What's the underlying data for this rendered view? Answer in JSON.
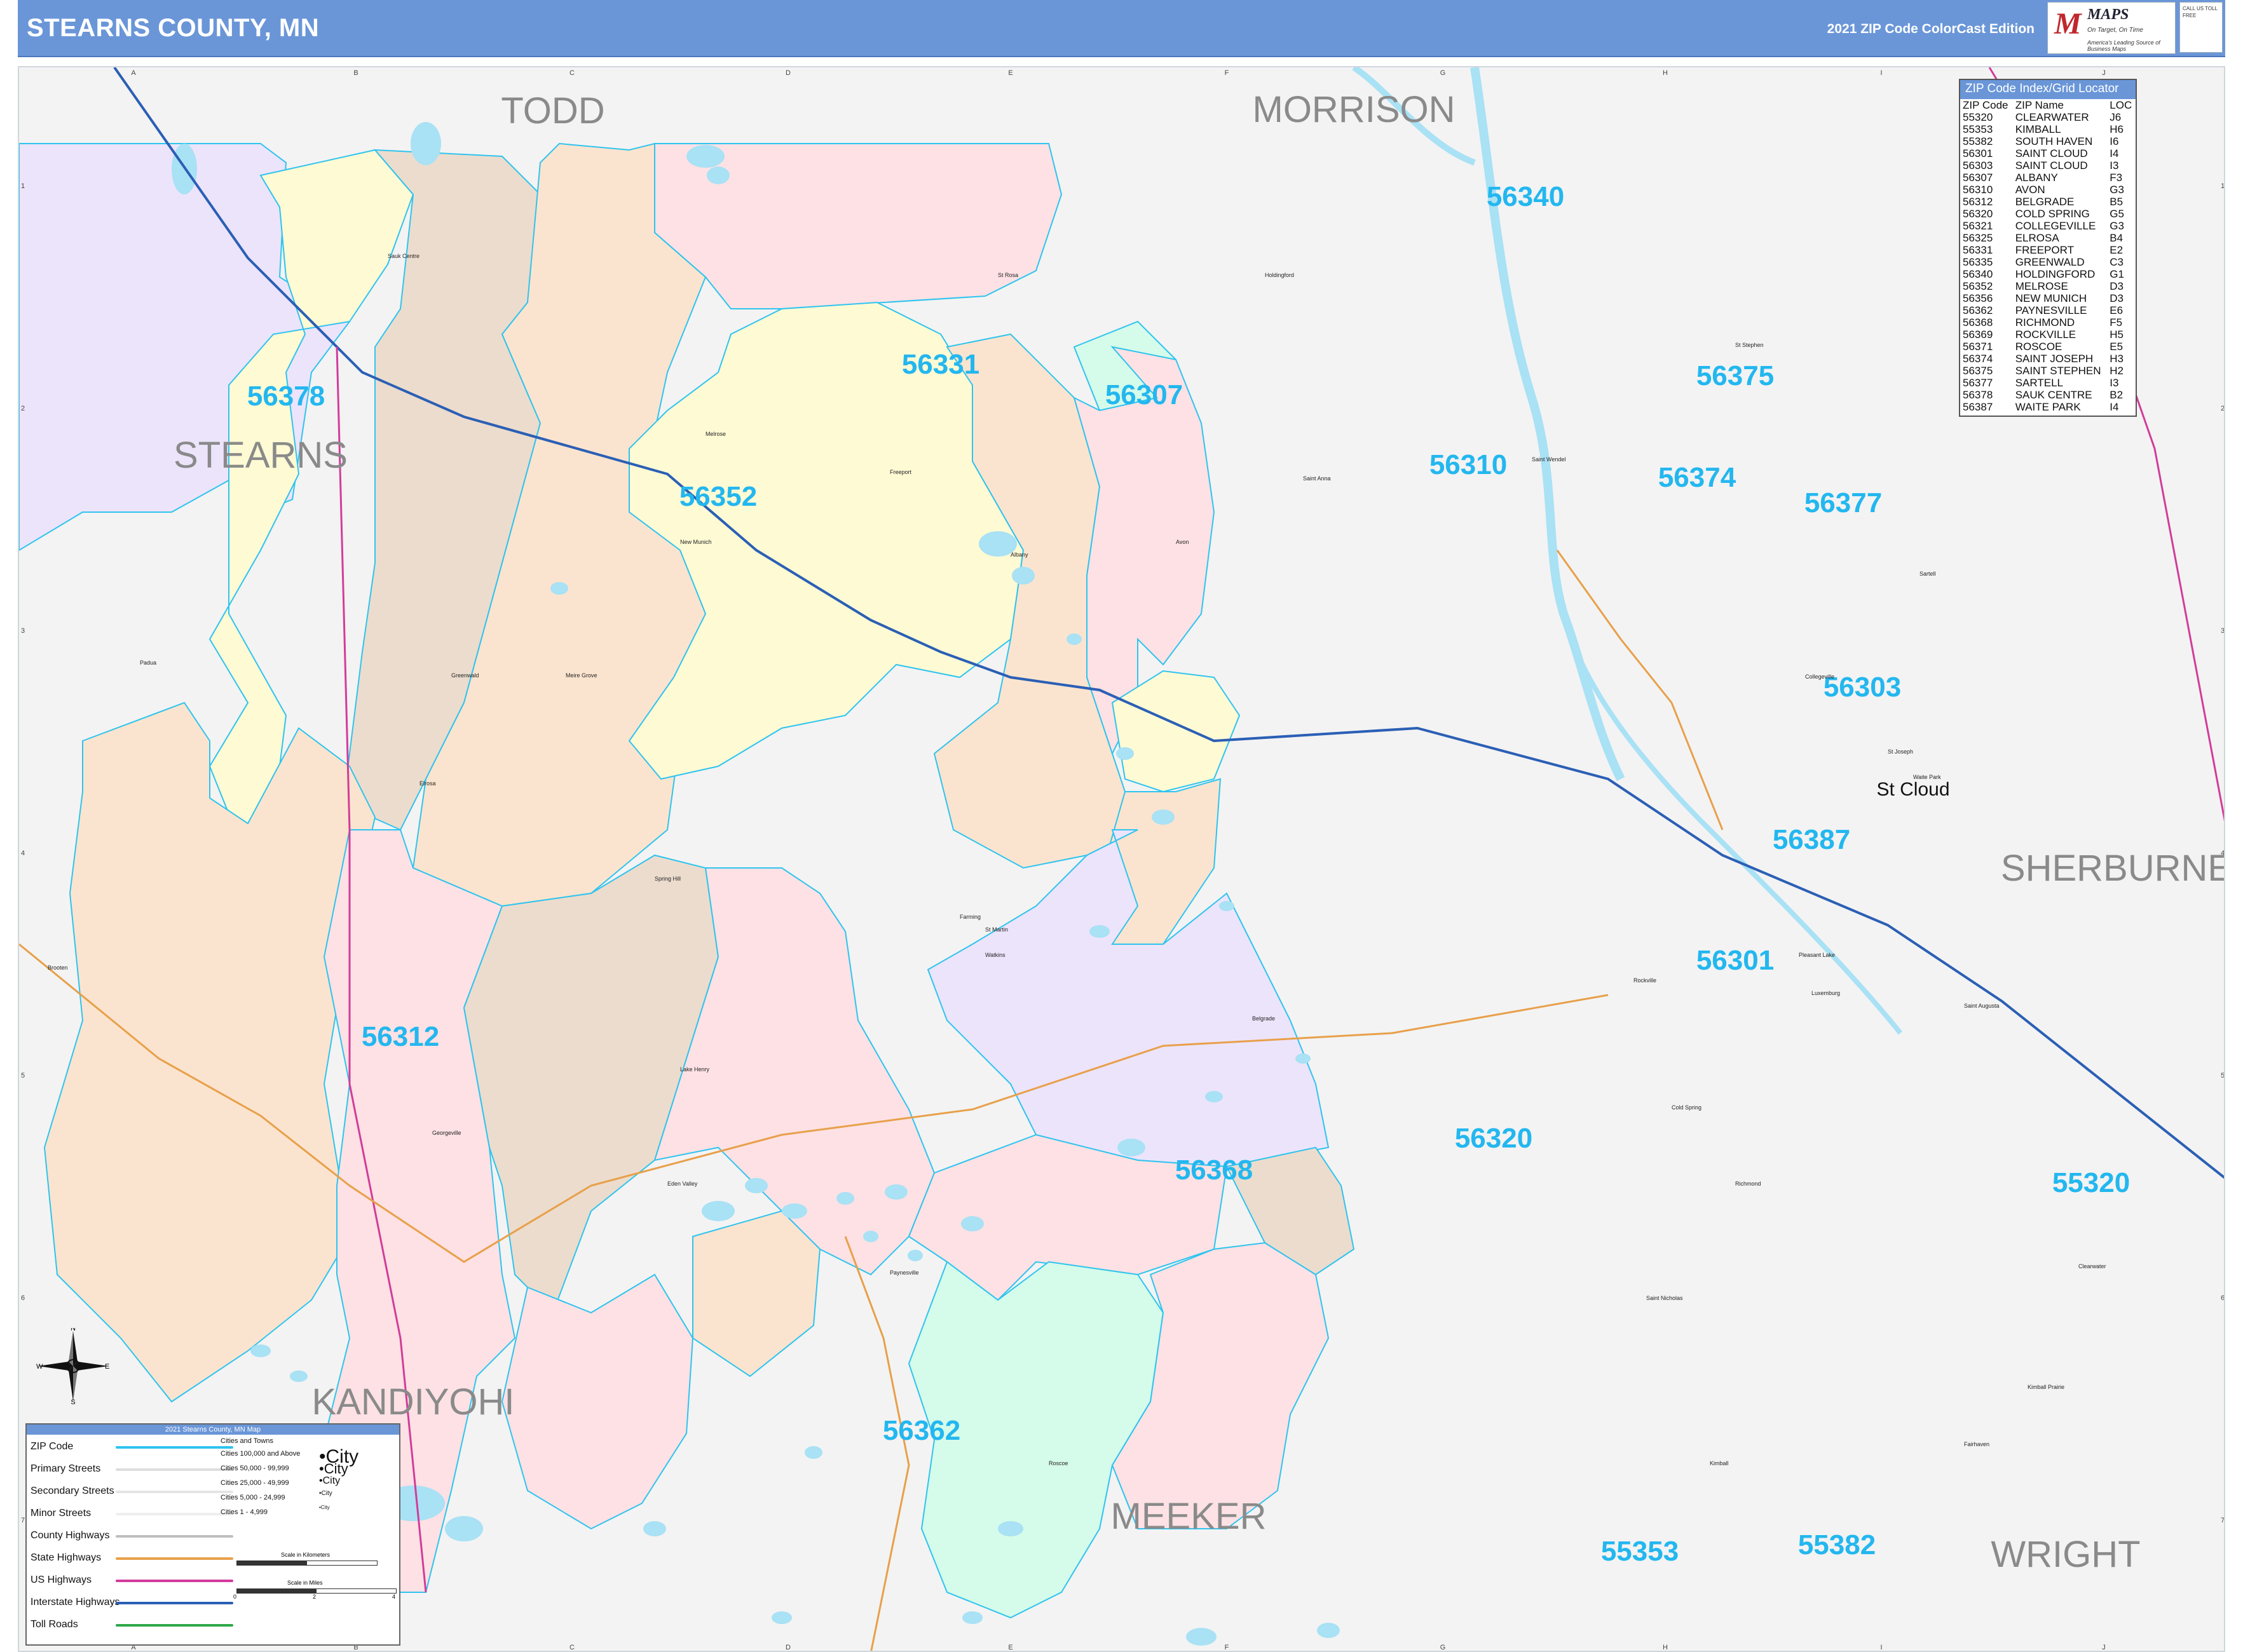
{
  "header": {
    "title": "STEARNS COUNTY, MN",
    "edition": "2021 ZIP Code ColorCast Edition",
    "brand_name": "MAPS",
    "brand_mark": "M",
    "brand_sub": "On Target, On Time",
    "brand_tag": "America's Leading Source of Business Maps",
    "contact": "CALL US TOLL FREE"
  },
  "counties": [
    "TODD",
    "MORRISON",
    "STEARNS",
    "SHERBURNE",
    "KANDIYOHI",
    "MEEKER",
    "WRIGHT"
  ],
  "zip_labels": [
    "56340",
    "56378",
    "56331",
    "56307",
    "56375",
    "56310",
    "56374",
    "56352",
    "56377",
    "56303",
    "56387",
    "56301",
    "56312",
    "56368",
    "56320",
    "55320",
    "56362",
    "55353",
    "55382"
  ],
  "city_label": "St Cloud",
  "towns": [
    "Sauk Centre",
    "Melrose",
    "Freeport",
    "New Munich",
    "Albany",
    "Avon",
    "Holdingford",
    "St Rosa",
    "St Stephen",
    "Saint Anna",
    "Saint Wendel",
    "Collegeville",
    "St Joseph",
    "Waite Park",
    "Sartell",
    "Cold Spring",
    "Richmond",
    "Roscoe",
    "Paynesville",
    "Kimball",
    "Clearwater",
    "Belgrade",
    "Brooten",
    "Elrosa",
    "Georgeville",
    "Lake Henry",
    "Farming",
    "St Martin",
    "Rockville",
    "Luxemburg",
    "Saint Augusta",
    "Pleasant Lake",
    "Saint Nicholas",
    "Eden Valley",
    "Greenwald",
    "Spring Hill",
    "Meire Grove",
    "Padua",
    "Watkins",
    "Fairhaven",
    "Kimball Prairie"
  ],
  "grid": {
    "letters": [
      "A",
      "B",
      "C",
      "D",
      "E",
      "F",
      "G",
      "H",
      "I",
      "J"
    ],
    "numbers": [
      "1",
      "2",
      "3",
      "4",
      "5",
      "6",
      "7"
    ]
  },
  "index": {
    "title": "ZIP Code Index/Grid Locator",
    "columns": [
      "ZIP Code",
      "ZIP Name",
      "LOC"
    ],
    "rows": [
      [
        "55320",
        "CLEARWATER",
        "J6"
      ],
      [
        "55353",
        "KIMBALL",
        "H6"
      ],
      [
        "55382",
        "SOUTH HAVEN",
        "I6"
      ],
      [
        "56301",
        "SAINT CLOUD",
        "I4"
      ],
      [
        "56303",
        "SAINT CLOUD",
        "I3"
      ],
      [
        "56307",
        "ALBANY",
        "F3"
      ],
      [
        "56310",
        "AVON",
        "G3"
      ],
      [
        "56312",
        "BELGRADE",
        "B5"
      ],
      [
        "56320",
        "COLD SPRING",
        "G5"
      ],
      [
        "56321",
        "COLLEGEVILLE",
        "G3"
      ],
      [
        "56325",
        "ELROSA",
        "B4"
      ],
      [
        "56331",
        "FREEPORT",
        "E2"
      ],
      [
        "56335",
        "GREENWALD",
        "C3"
      ],
      [
        "56340",
        "HOLDINGFORD",
        "G1"
      ],
      [
        "56352",
        "MELROSE",
        "D3"
      ],
      [
        "56356",
        "NEW MUNICH",
        "D3"
      ],
      [
        "56362",
        "PAYNESVILLE",
        "E6"
      ],
      [
        "56368",
        "RICHMOND",
        "F5"
      ],
      [
        "56369",
        "ROCKVILLE",
        "H5"
      ],
      [
        "56371",
        "ROSCOE",
        "E5"
      ],
      [
        "56374",
        "SAINT JOSEPH",
        "H3"
      ],
      [
        "56375",
        "SAINT STEPHEN",
        "H2"
      ],
      [
        "56377",
        "SARTELL",
        "I3"
      ],
      [
        "56378",
        "SAUK CENTRE",
        "B2"
      ],
      [
        "56387",
        "WAITE PARK",
        "I4"
      ]
    ]
  },
  "legend": {
    "title": "2021 Stearns County, MN Map",
    "cities_heading": "Cities and Towns",
    "rows": [
      {
        "label": "ZIP Code",
        "color": "#2ec4ef"
      },
      {
        "label": "Primary Streets",
        "color": "#dddddd"
      },
      {
        "label": "Secondary Streets",
        "color": "#e5e5e5"
      },
      {
        "label": "Minor Streets",
        "color": "#eeeeee"
      },
      {
        "label": "County Highways",
        "color": "#bfbfbf"
      },
      {
        "label": "State Highways",
        "color": "#e8a04a"
      },
      {
        "label": "US Highways",
        "color": "#d23c9a"
      },
      {
        "label": "Interstate Highways",
        "color": "#2b5fb5"
      },
      {
        "label": "Toll Roads",
        "color": "#2ea84a"
      }
    ],
    "city_sizes": [
      {
        "label": "Cities 100,000 and Above",
        "sample": "City",
        "size": "30px"
      },
      {
        "label": "Cities 50,000 - 99,999",
        "sample": "City",
        "size": "22px"
      },
      {
        "label": "Cities 25,000 - 49,999",
        "sample": "City",
        "size": "16px"
      },
      {
        "label": "Cities 5,000 - 24,999",
        "sample": "City",
        "size": "10px"
      },
      {
        "label": "Cities 1 - 4,999",
        "sample": "City",
        "size": "8px"
      }
    ],
    "scale_km": "Scale in Kilometers",
    "scale_mi": "Scale in Miles",
    "scale_ticks": [
      "0",
      "2",
      "4"
    ]
  },
  "compass": {
    "n": "N",
    "s": "S",
    "e": "E",
    "w": "W"
  },
  "colors": {
    "purple": "#ece4fb",
    "yellow": "#fdfad4",
    "tan": "#ecdccd",
    "orange": "#fbe4cf",
    "pink": "#fde1e4",
    "green": "#d5fbea",
    "zip_border": "#2ec4ef",
    "zip_text": "#23b7ef",
    "outside": "#f3f3f3",
    "water": "#a9e1f5"
  }
}
